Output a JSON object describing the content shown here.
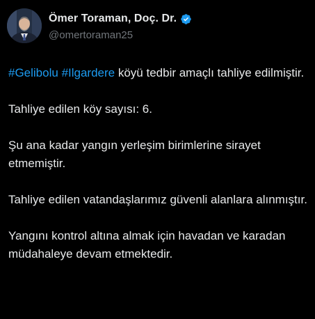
{
  "author": {
    "display_name": "Ömer Toraman, Doç. Dr.",
    "handle": "@omertoraman25",
    "verified": true,
    "verified_color": "#1d9bf0"
  },
  "tweet": {
    "hashtags": [
      "#Gelibolu",
      "#Ilgardere"
    ],
    "first_para_rest": " köyü tedbir amaçlı tahliye edilmiştir.",
    "paragraphs": [
      "Tahliye edilen köy sayısı: 6.",
      "Şu ana kadar yangın yerleşim birimlerine sirayet etmemiştir.",
      "Tahliye edilen vatandaşlarımız güvenli alanlara alınmıştır.",
      "Yangını kontrol altına almak için havadan ve karadan müdahaleye devam etmektedir."
    ]
  },
  "icons": {
    "verified": "verified-badge-icon",
    "avatar": "profile-photo"
  },
  "colors": {
    "background": "#000000",
    "text": "#e7e9ea",
    "secondary_text": "#71767b",
    "link": "#1d9bf0"
  }
}
